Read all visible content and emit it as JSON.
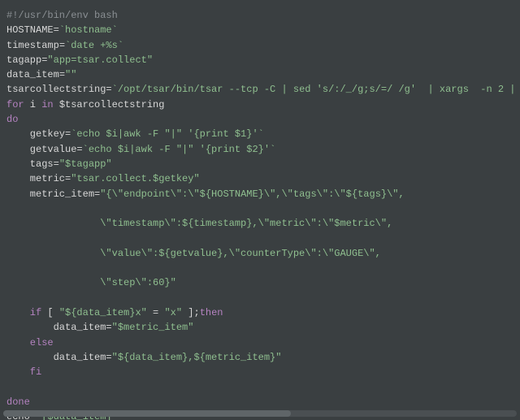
{
  "code": {
    "l01_shebang": "#!/usr/bin/env bash",
    "l02_a": "HOSTNAME",
    "l02_b": "=",
    "l02_c": "`hostname`",
    "l03_a": "timestamp",
    "l03_b": "=",
    "l03_c": "`date +%s`",
    "l04_a": "tagapp",
    "l04_b": "=",
    "l04_c": "\"app=tsar.collect\"",
    "l05_a": "data_item",
    "l05_b": "=",
    "l05_c": "\"\"",
    "l06_a": "tsarcollectstring",
    "l06_b": "=",
    "l06_c": "`/opt/tsar/bin/tsar --tcp -C | sed 's/:/_/g;s/=/ /g'  | xargs  -n 2 |",
    "l07_a": "for",
    "l07_b": " i ",
    "l07_c": "in",
    "l07_d": " $tsarcollectstring",
    "l08": "do",
    "l09_a": "    getkey",
    "l09_b": "=",
    "l09_c": "`echo $i|awk -F \"|\" '{print $1}'`",
    "l10_a": "    getvalue",
    "l10_b": "=",
    "l10_c": "`echo $i|awk -F \"|\" '{print $2}'`",
    "l11_a": "    tags",
    "l11_b": "=",
    "l11_c": "\"$tagapp\"",
    "l12_a": "    metric",
    "l12_b": "=",
    "l12_c": "\"tsar.collect.$getkey\"",
    "l13_a": "    metric_item",
    "l13_b": "=",
    "l13_c": "\"{\\\"endpoint\\\":\\\"${HOSTNAME}\\\",\\\"tags\\\":\\\"${tags}\\\",",
    "l14_blank": "",
    "l15_c": "                \\\"timestamp\\\":${timestamp},\\\"metric\\\":\\\"$metric\\\",",
    "l16_blank": "",
    "l17_c": "                \\\"value\\\":${getvalue},\\\"counterType\\\":\\\"GAUGE\\\",",
    "l18_blank": "",
    "l19_c": "                \\\"step\\\":60}\"",
    "l20_blank": "",
    "l21_a": "    if",
    "l21_b": " [ ",
    "l21_c": "\"${data_item}x\"",
    "l21_d": " = ",
    "l21_e": "\"x\"",
    "l21_f": " ];",
    "l21_g": "then",
    "l22_a": "        data_item",
    "l22_b": "=",
    "l22_c": "\"$metric_item\"",
    "l23": "    else",
    "l24_a": "        data_item",
    "l24_b": "=",
    "l24_c": "\"${data_item},${metric_item}\"",
    "l25": "    fi",
    "l26_blank": "",
    "l27": "done",
    "l28_a": "echo",
    "l28_b": " ",
    "l28_c": "\"[$data_item]\""
  }
}
